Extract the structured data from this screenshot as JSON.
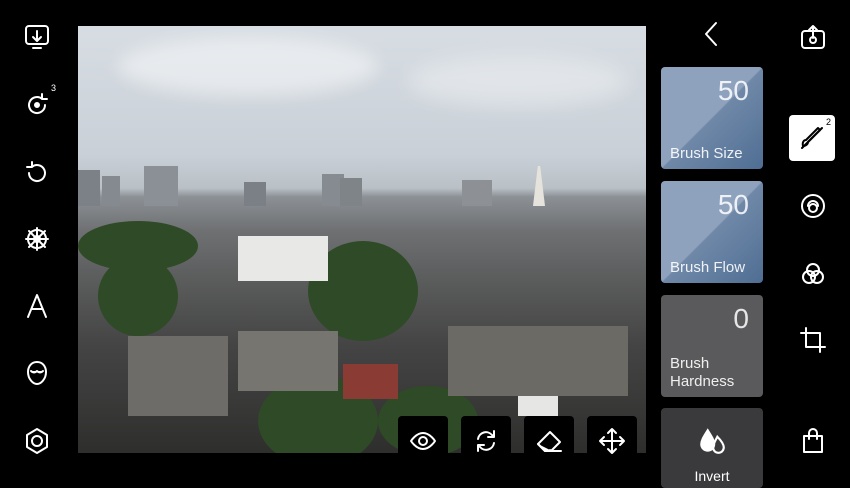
{
  "left_toolbar": {
    "redo_badge": "3"
  },
  "photo": {
    "description_icon": "photo-canvas"
  },
  "brush_panel": {
    "back_icon": "chevron-left-icon",
    "brush_size": {
      "value": "50",
      "label": "Brush Size"
    },
    "brush_flow": {
      "value": "50",
      "label": "Brush Flow"
    },
    "brush_hardness": {
      "value": "0",
      "label": "Brush Hardness"
    },
    "invert": {
      "label": "Invert"
    }
  },
  "right_toolbar": {
    "brush_badge": "2"
  },
  "bottom_tools": [
    "eye-icon",
    "swap-icon",
    "eraser-icon",
    "move-icon"
  ],
  "colors": {
    "accent_card": "#6f88a8",
    "gray_card": "#5a5a5c"
  }
}
